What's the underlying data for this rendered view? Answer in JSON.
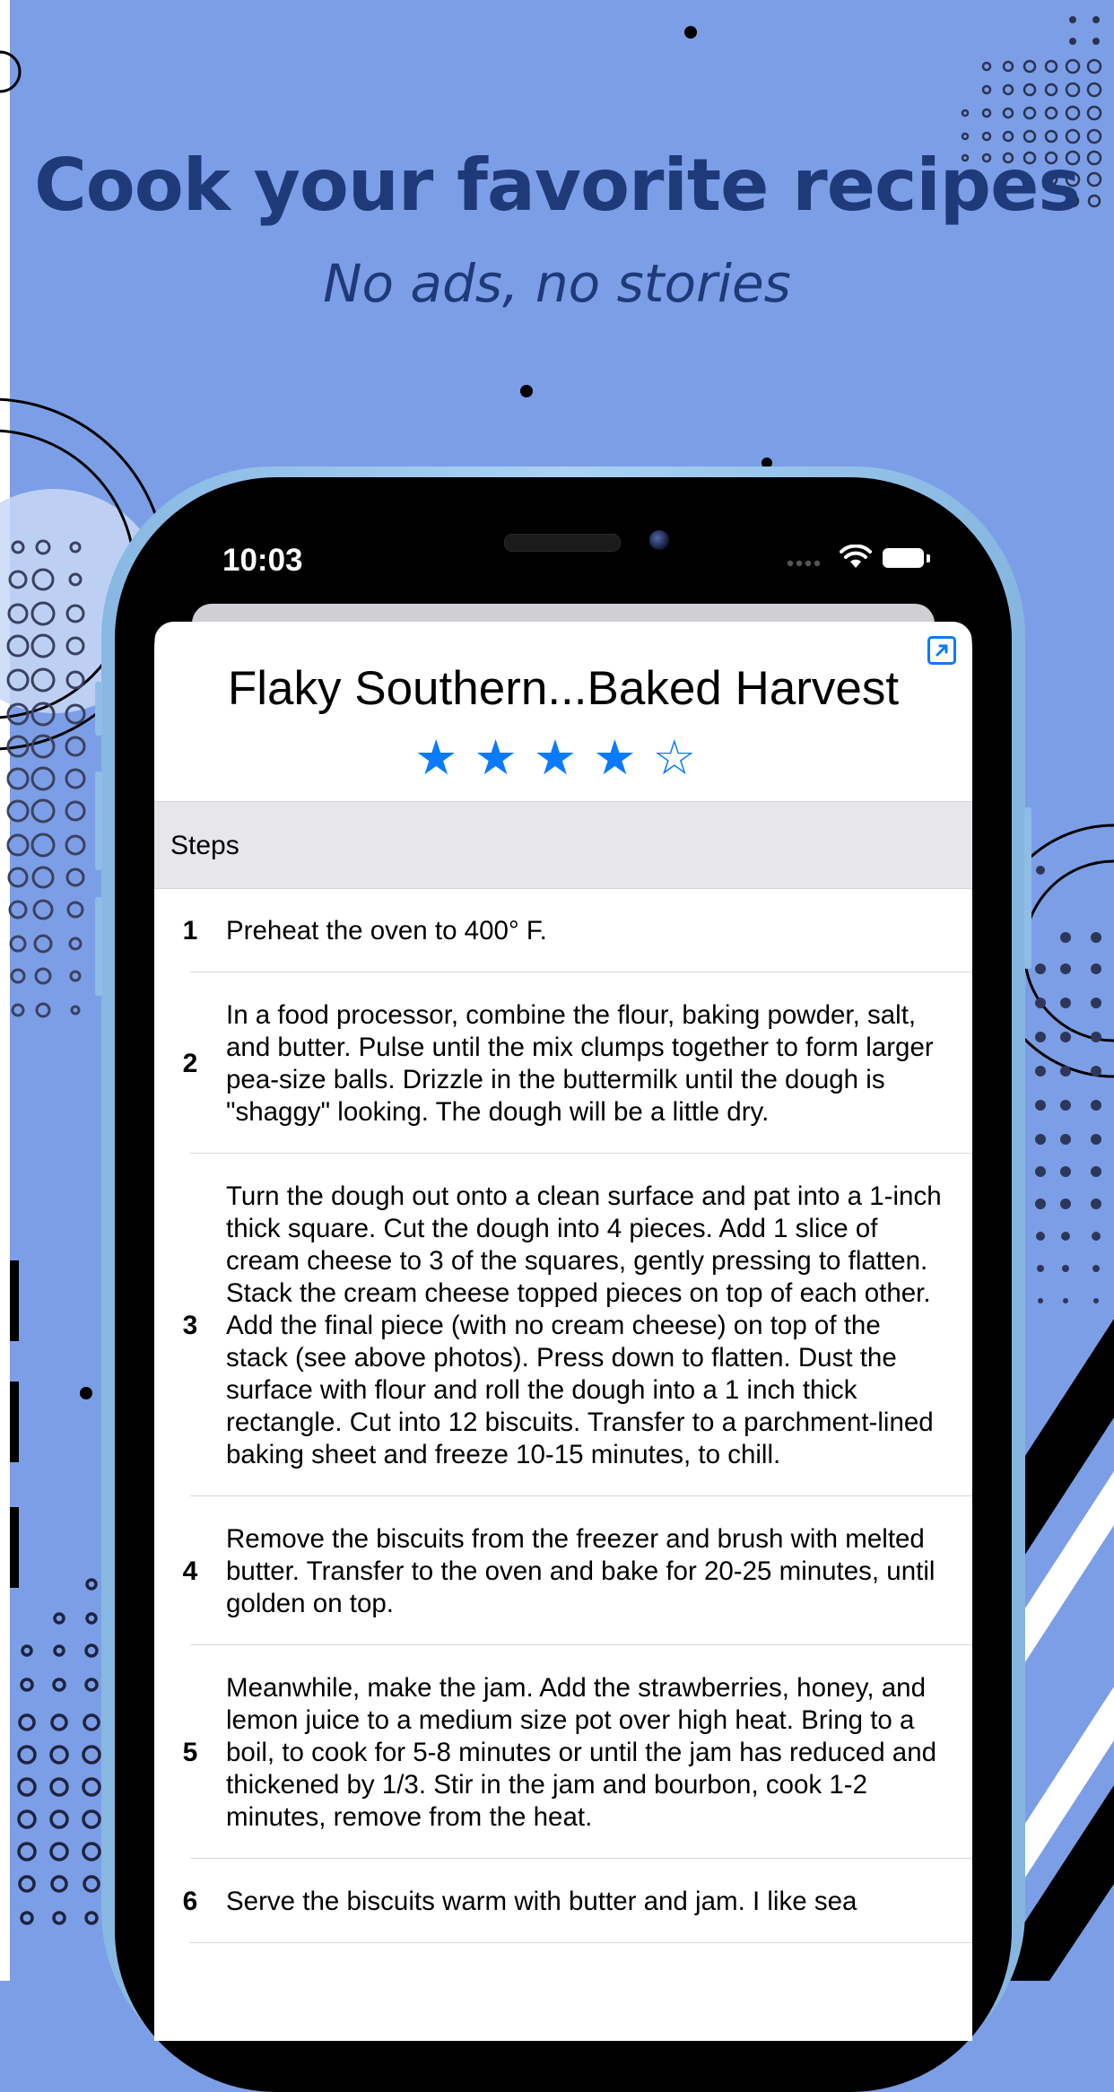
{
  "marketing": {
    "headline": "Cook your favorite recipes",
    "subheadline": "No ads, no stories"
  },
  "colors": {
    "background": "#7c9ee6",
    "headline": "#1e3a78",
    "accent": "#0a7aff"
  },
  "status_bar": {
    "time": "10:03"
  },
  "recipe": {
    "title": "Flaky Southern...Baked Harvest",
    "rating": 4,
    "rating_max": 5,
    "stars_display": "★★★★☆",
    "share_icon": "open-external-icon"
  },
  "steps_section": {
    "label": "Steps",
    "items": [
      {
        "number": "1",
        "text": "Preheat the oven to 400° F."
      },
      {
        "number": "2",
        "text": "In a food processor, combine the flour, baking powder, salt, and butter. Pulse until the mix clumps together to form larger pea-size balls. Drizzle in the buttermilk until the dough is \"shaggy\" looking. The dough will be a little dry."
      },
      {
        "number": "3",
        "text": "Turn the dough out onto a clean surface and pat into a 1-inch thick square. Cut the dough into 4 pieces. Add 1 slice of cream cheese to 3 of the squares, gently pressing to flatten. Stack the cream cheese topped pieces on top of each other. Add the final piece (with no cream cheese) on top of the stack (see above photos). Press down to flatten. Dust the surface with flour and roll the dough into a 1 inch thick rectangle. Cut into 12 biscuits. Transfer to a parchment-lined baking sheet and freeze 10-15 minutes, to chill."
      },
      {
        "number": "4",
        "text": "Remove the biscuits from the freezer and brush with melted butter. Transfer to the oven and bake for 20-25 minutes, until golden on top."
      },
      {
        "number": "5",
        "text": "Meanwhile, make the jam. Add the strawberries, honey, and lemon juice to a medium size pot over high heat. Bring to a boil, to cook for 5-8 minutes or until the jam has reduced and thickened by 1/3. Stir in the jam and bourbon, cook 1-2 minutes, remove from the heat."
      },
      {
        "number": "6",
        "text": "Serve the biscuits warm with butter and jam. I like sea"
      }
    ]
  }
}
